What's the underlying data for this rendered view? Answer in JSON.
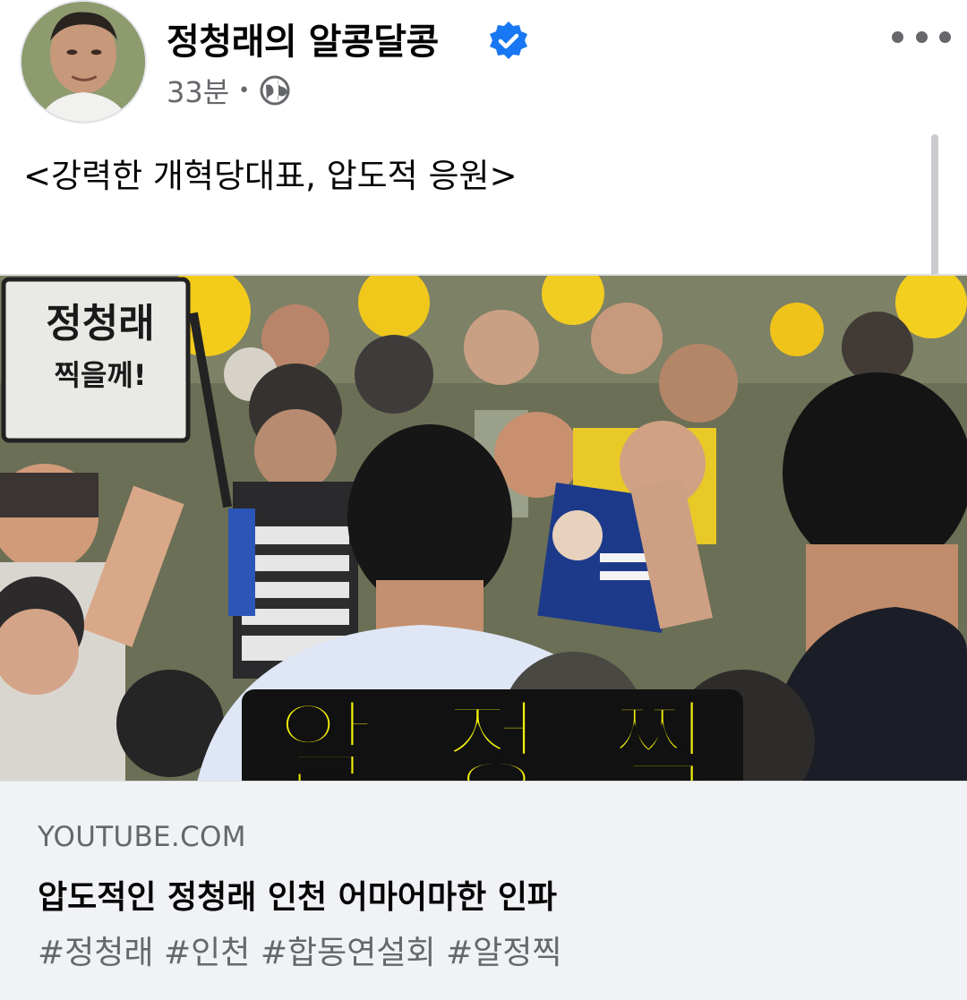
{
  "post": {
    "author": "정청래의 알콩달콩",
    "time": "33분",
    "separator": "•",
    "text": "<강력한 개혁당대표, 압도적 응원>"
  },
  "media": {
    "overlay_chars": [
      "알",
      "정",
      "찍"
    ],
    "sign_main": "정청래",
    "sign_sub": "찍을께!"
  },
  "link": {
    "domain": "YOUTUBE.COM",
    "title": "압도적인 정청래 인천 어마어마한 인파",
    "description": "#정청래 #인천 #합동연설회 #알정찍"
  },
  "colors": {
    "verified": "#1877f2",
    "secondary_text": "#65676b",
    "link_bg": "#f0f2f5",
    "overlay_yellow": "#f3f00a"
  },
  "icons": {
    "verified": "verified-badge-icon",
    "privacy": "globe-icon",
    "more": "more-options-icon"
  }
}
